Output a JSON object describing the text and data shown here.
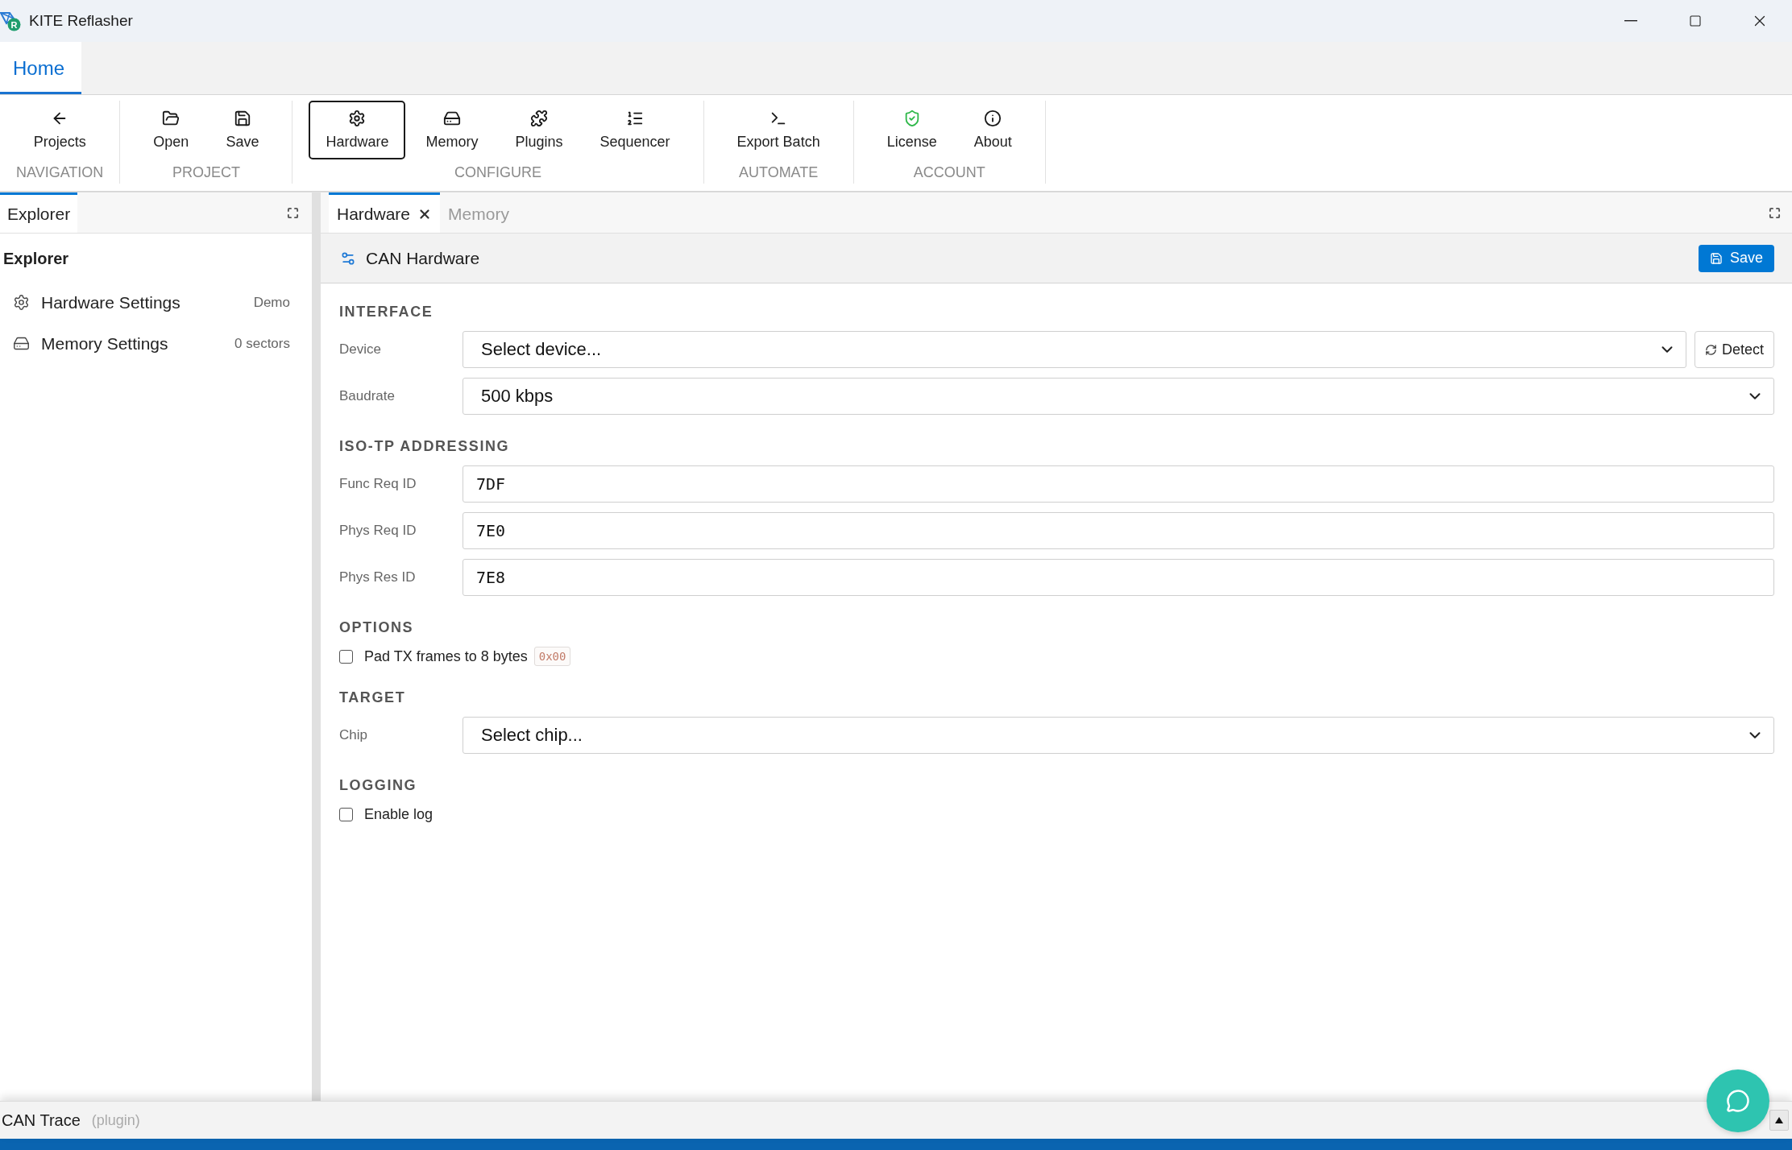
{
  "window": {
    "title": "KITE Reflasher",
    "logo_letter": "R"
  },
  "ribbon_tabs": [
    {
      "label": "Home",
      "selected": true
    }
  ],
  "ribbon_groups": [
    {
      "label": "NAVIGATION",
      "items": [
        {
          "label": "Projects",
          "selected": false
        }
      ]
    },
    {
      "label": "PROJECT",
      "items": [
        {
          "label": "Open",
          "selected": false
        },
        {
          "label": "Save",
          "selected": false
        }
      ]
    },
    {
      "label": "CONFIGURE",
      "items": [
        {
          "label": "Hardware",
          "selected": true
        },
        {
          "label": "Memory",
          "selected": false
        },
        {
          "label": "Plugins",
          "selected": false
        },
        {
          "label": "Sequencer",
          "selected": false
        }
      ]
    },
    {
      "label": "AUTOMATE",
      "items": [
        {
          "label": "Export Batch",
          "selected": false
        }
      ]
    },
    {
      "label": "ACCOUNT",
      "items": [
        {
          "label": "License",
          "selected": false
        },
        {
          "label": "About",
          "selected": false
        }
      ]
    }
  ],
  "explorer": {
    "tabs": [
      {
        "label": "Explorer",
        "selected": true
      }
    ],
    "title": "Explorer",
    "items": [
      {
        "label": "Hardware Settings",
        "detail": "Demo"
      },
      {
        "label": "Memory Settings",
        "detail": "0 sectors"
      }
    ]
  },
  "editor": {
    "tabs": [
      {
        "label": "Hardware",
        "selected": true
      },
      {
        "label": "Memory",
        "selected": false
      }
    ],
    "header": {
      "title": "CAN Hardware",
      "save_button": "Save"
    },
    "sections": [
      {
        "title": "INTERFACE",
        "fields": [
          {
            "kind": "select",
            "label": "Device",
            "value": "Select device...",
            "button": "Detect"
          },
          {
            "kind": "select",
            "label": "Baudrate",
            "value": "500 kbps"
          }
        ]
      },
      {
        "title": "ISO-TP ADDRESSING",
        "fields": [
          {
            "kind": "text",
            "label": "Func Req ID",
            "value": "7DF"
          },
          {
            "kind": "text",
            "label": "Phys Req ID",
            "value": "7E0"
          },
          {
            "kind": "text",
            "label": "Phys Res ID",
            "value": "7E8"
          }
        ]
      },
      {
        "title": "OPTIONS",
        "fields": [
          {
            "kind": "checkbox",
            "label": "Pad TX frames to 8 bytes",
            "checked": false,
            "badge": "0x00"
          }
        ]
      },
      {
        "title": "TARGET",
        "fields": [
          {
            "kind": "select",
            "label": "Chip",
            "value": "Select chip..."
          }
        ]
      },
      {
        "title": "LOGGING",
        "fields": [
          {
            "kind": "checkbox",
            "label": "Enable log",
            "checked": false
          }
        ]
      }
    ]
  },
  "bottom_panel": {
    "title": "CAN Trace",
    "subtitle": "(plugin)"
  }
}
